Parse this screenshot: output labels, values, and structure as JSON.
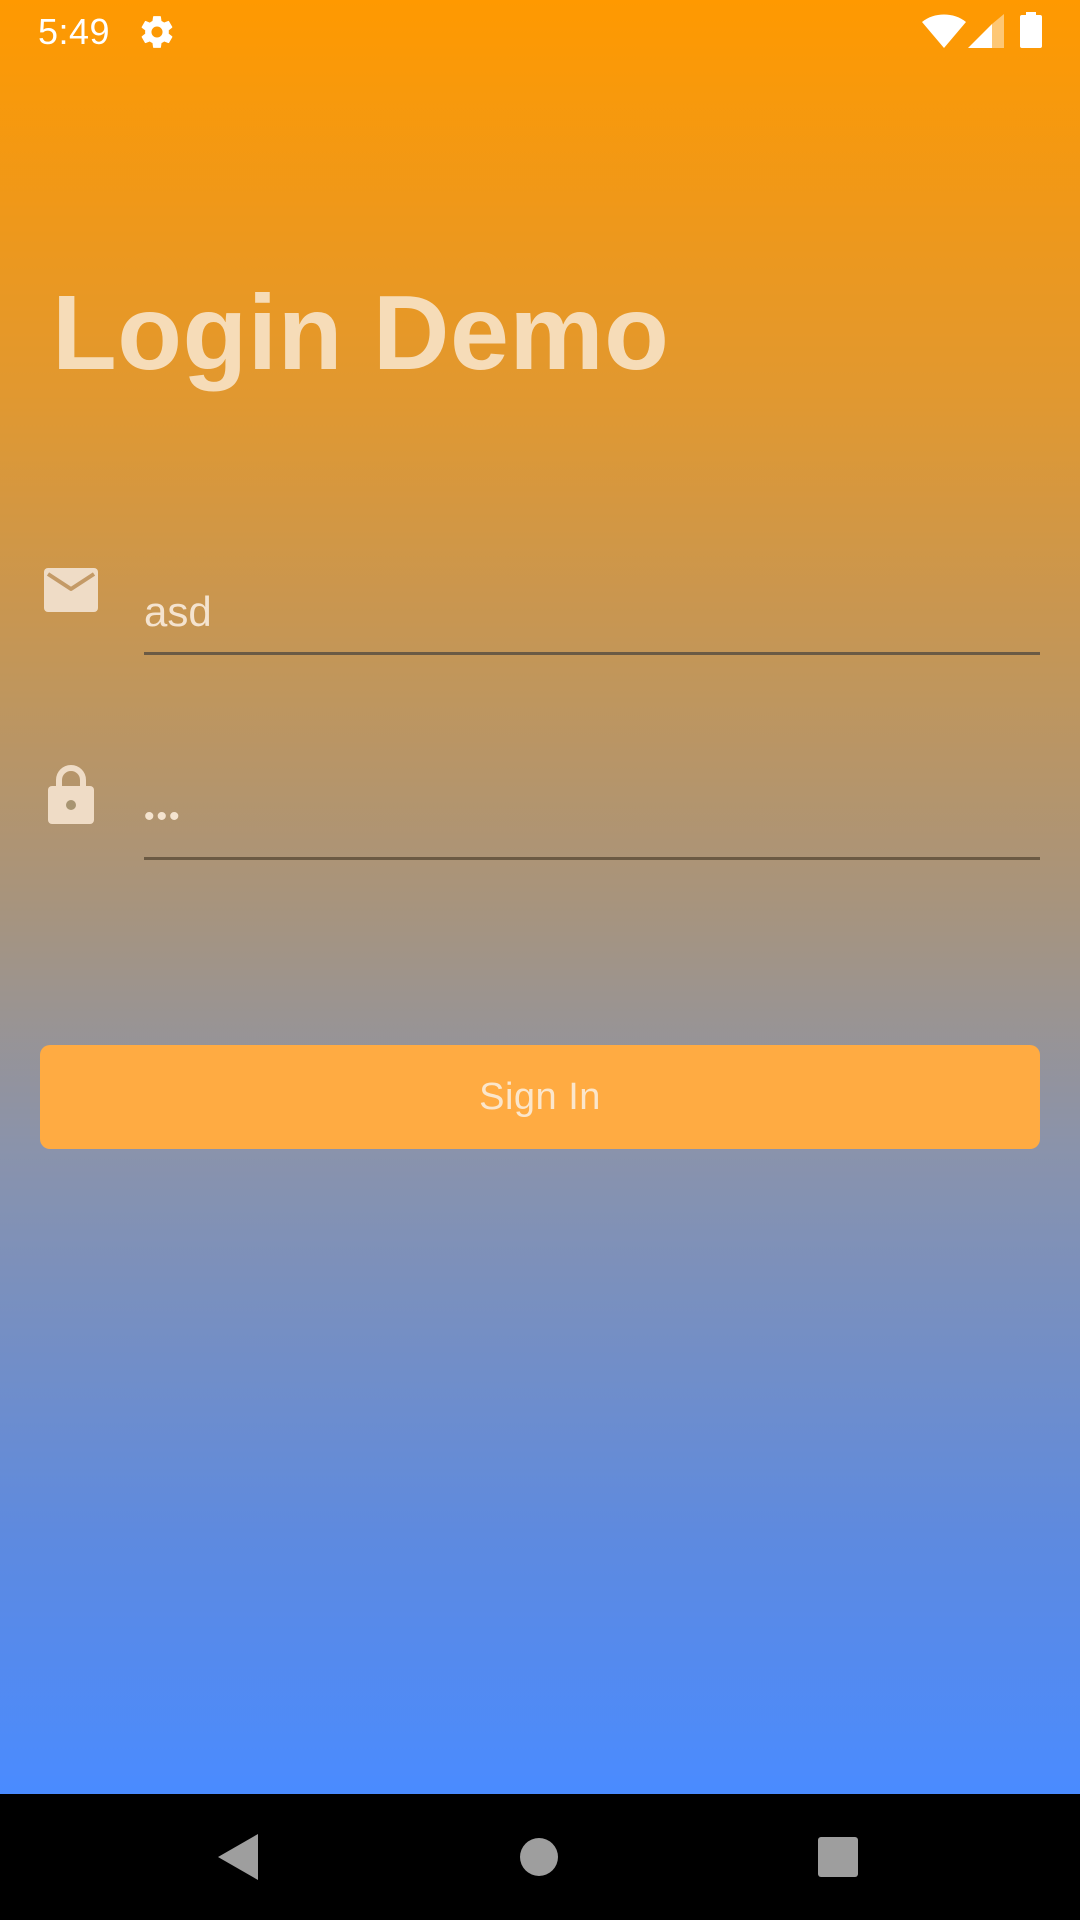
{
  "status_bar": {
    "time": "5:49",
    "icons": [
      "gear-icon",
      "wifi-icon",
      "signal-icon",
      "battery-icon"
    ]
  },
  "app": {
    "title": "Login Demo",
    "email": {
      "icon": "envelope-icon",
      "value": "asd"
    },
    "password": {
      "icon": "lock-icon",
      "value": "•••"
    },
    "sign_in_label": "Sign In"
  },
  "navigation": {
    "buttons": [
      "back-icon",
      "home-icon",
      "recents-icon"
    ]
  },
  "colors": {
    "gradient_top": "#ff9900",
    "gradient_bottom": "#4a8bff",
    "button": "#ffab42",
    "title": "#f6dcb8"
  }
}
